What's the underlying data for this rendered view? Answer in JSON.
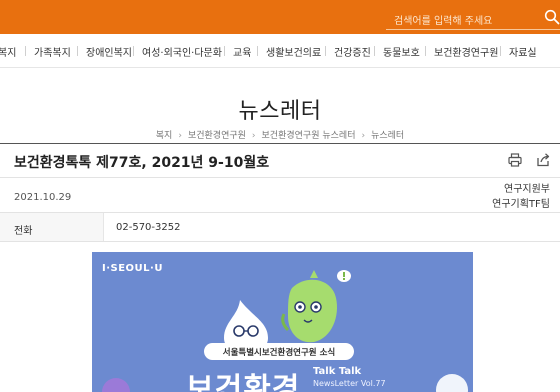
{
  "search": {
    "placeholder": "검색어를 입력해 주세요",
    "icon": "search-icon"
  },
  "nav": {
    "items": [
      "복지",
      "가족복지",
      "장애인복지",
      "여성·외국인·다문화",
      "교육",
      "생활보건의료",
      "건강증진",
      "동물보호",
      "보건환경연구원",
      "자료실"
    ]
  },
  "page": {
    "title": "뉴스레터",
    "breadcrumb": [
      "복지",
      "보건환경연구원",
      "보건환경연구원 뉴스레터",
      "뉴스레터"
    ]
  },
  "article": {
    "title": "보건환경톡톡 제77호, 2021년 9-10월호",
    "date": "2021.10.29",
    "department": "연구지원부",
    "team": "연구기획TF팀",
    "phone_label": "전화",
    "phone": "02-570-3252"
  },
  "cover": {
    "brand": "I·SEOUL·U",
    "pill_text": "서울특별시보건환경연구원 소식",
    "talk": "Talk Talk",
    "vol": "NewsLetter Vol.77",
    "big_title": "보건환경"
  },
  "colors": {
    "brand_orange": "#e8700f",
    "cover_blue": "#6c8ad0",
    "character_green": "#a6dc6e"
  }
}
